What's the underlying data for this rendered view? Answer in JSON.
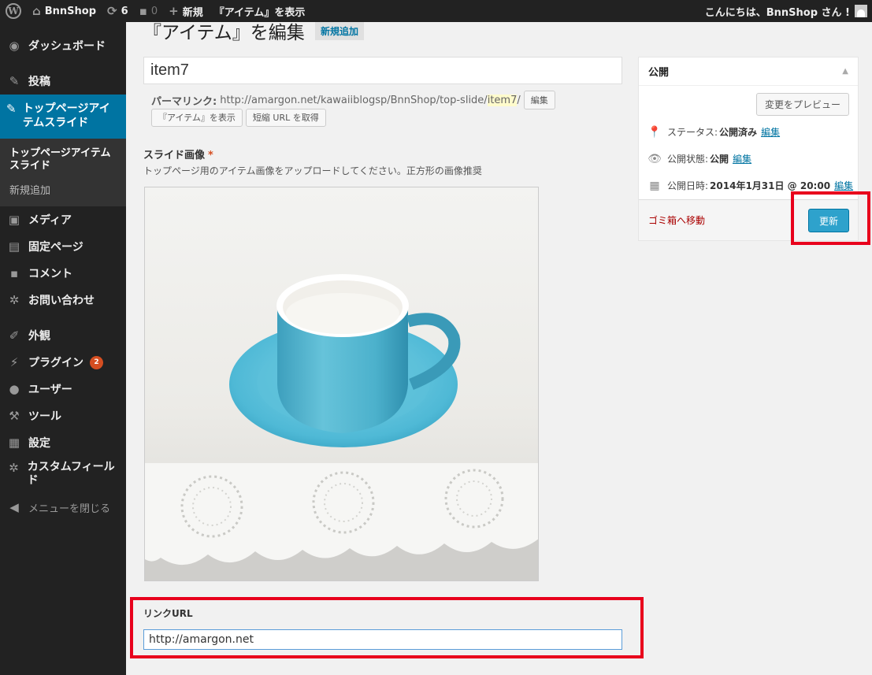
{
  "adminbar": {
    "site_name": "BnnShop",
    "updates_count": "6",
    "comments_count": "0",
    "new_label": "新規",
    "view_item_label": "『アイテム』を表示",
    "greeting": "こんにちは、BnnShop さん !",
    "icons": [
      "wordpress-icon",
      "home-icon",
      "refresh-icon",
      "comment-icon",
      "plus-icon",
      "avatar"
    ]
  },
  "sidebar": {
    "dashboard": "ダッシュボード",
    "posts": "投稿",
    "current": "トップページアイテムスライド",
    "sub_active": "トップページアイテムスライド",
    "sub_add_new": "新規追加",
    "media": "メディア",
    "pages": "固定ページ",
    "comments": "コメント",
    "contact": "お問い合わせ",
    "appearance": "外観",
    "plugins": "プラグイン",
    "plugins_badge": "2",
    "users": "ユーザー",
    "tools": "ツール",
    "settings": "設定",
    "custom_fields": "カスタムフィールド",
    "collapse": "メニューを閉じる"
  },
  "main": {
    "page_title": "『アイテム』を編集",
    "add_new": "新規追加",
    "title_value": "item7",
    "permalink_label": "パーマリンク:",
    "permalink_base": "http://amargon.net/kawaiiblogsp/BnnShop/top-slide/",
    "permalink_slug": "item7",
    "permalink_end": "/",
    "edit_button": "編集",
    "view_button": "『アイテム』を表示",
    "shortlink_button": "短縮 URL を取得",
    "slide_image_label": "スライド画像",
    "required_mark": "*",
    "slide_image_desc": "トップページ用のアイテム画像をアップロードしてください。正方形の画像推奨",
    "link_label": "リンクURL",
    "link_value": "http://amargon.net"
  },
  "publish": {
    "title": "公開",
    "preview_button": "変更をプレビュー",
    "status_label": "ステータス:",
    "status_value": "公開済み",
    "visibility_label": "公開状態:",
    "visibility_value": "公開",
    "date_label": "公開日時:",
    "date_value": "2014年1月31日 @ 20:00",
    "edit_link": "編集",
    "trash_link": "ゴミ箱へ移動",
    "update_button": "更新"
  },
  "colors": {
    "highlight_box": "#e8001c",
    "primary_button": "#2ea2cc",
    "sidebar_current": "#0074a2"
  }
}
